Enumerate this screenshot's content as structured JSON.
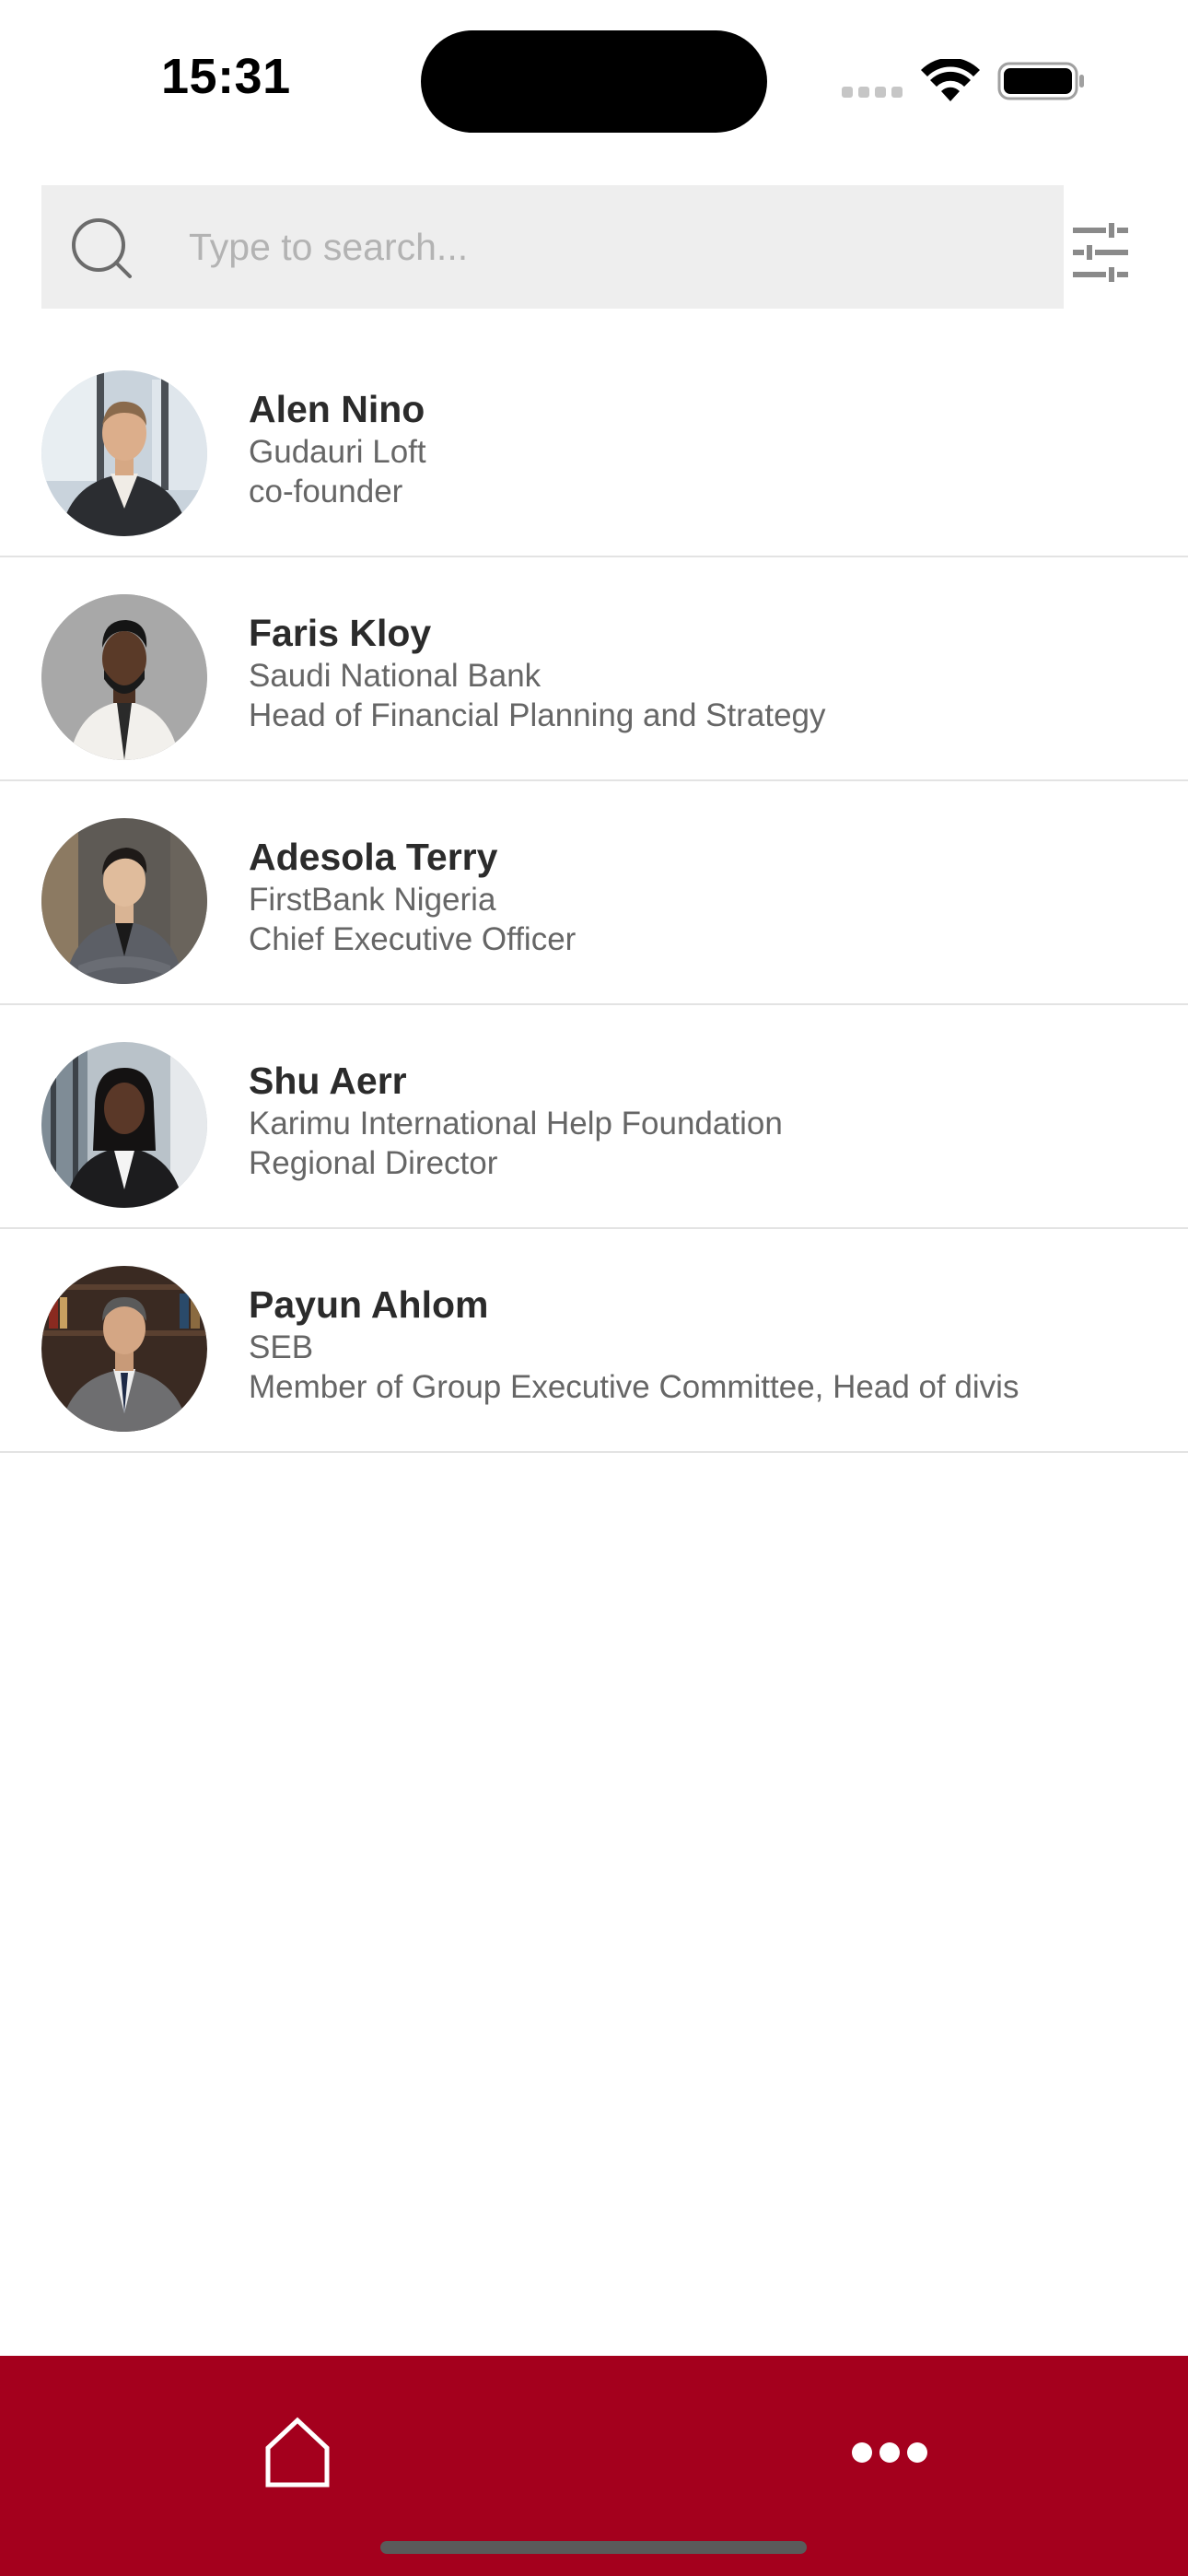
{
  "status_bar": {
    "time": "15:31"
  },
  "search": {
    "placeholder": "Type to search...",
    "value": ""
  },
  "contacts": [
    {
      "name": "Alen Nino",
      "company": "Gudauri Loft",
      "role": "co-founder"
    },
    {
      "name": "Faris Kloy",
      "company": "Saudi National Bank",
      "role": "Head of Financial Planning and Strategy"
    },
    {
      "name": "Adesola Terry",
      "company": "FirstBank Nigeria",
      "role": "Chief Executive Officer"
    },
    {
      "name": "Shu Aerr",
      "company": "Karimu International Help Foundation",
      "role": "Regional Director"
    },
    {
      "name": "Payun Ahlom",
      "company": "SEB",
      "role": "Member of Group Executive Committee, Head of divis"
    }
  ],
  "icons": {
    "search": "search-icon",
    "filter": "sliders-icon",
    "home": "home-icon",
    "more": "more-horizontal-icon"
  },
  "colors": {
    "brand": "#a4001d",
    "search_bg": "#eeeeee",
    "divider": "#e3e3e3"
  }
}
